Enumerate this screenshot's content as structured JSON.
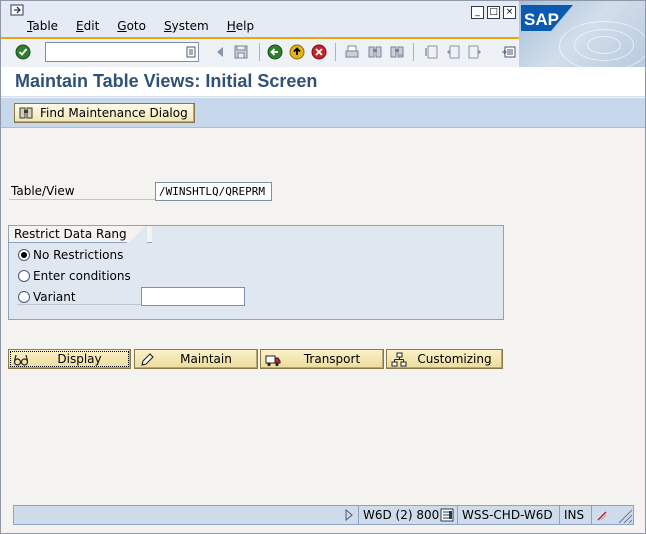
{
  "menu": {
    "items": [
      {
        "label": "Table",
        "u": "T",
        "rest": "able"
      },
      {
        "label": "Edit",
        "u": "E",
        "rest": "dit"
      },
      {
        "label": "Goto",
        "u": "G",
        "rest": "oto"
      },
      {
        "label": "System",
        "u": "S",
        "rest": "ystem"
      },
      {
        "label": "Help",
        "u": "H",
        "rest": "elp"
      }
    ]
  },
  "window_buttons": {
    "minimize": "_",
    "maximize": "□",
    "close": "×"
  },
  "logo": {
    "text": "SAP"
  },
  "toolbar": {
    "command_value": "",
    "icons": [
      "enter-icon",
      "command-dropdown-icon",
      "back-arrow-icon",
      "save-icon",
      "back-icon",
      "exit-icon",
      "cancel-icon",
      "print-icon",
      "find-icon",
      "find-next-icon",
      "first-page-icon",
      "previous-page-icon",
      "next-page-icon",
      "last-page-icon",
      "create-session-icon"
    ]
  },
  "title": "Maintain Table Views: Initial Screen",
  "app_toolbar": {
    "find_button": "Find Maintenance Dialog"
  },
  "form": {
    "table_view_label": "Table/View",
    "table_view_value": "/WINSHTLQ/QREPRM"
  },
  "restrict": {
    "title": "Restrict Data Range",
    "options": [
      {
        "label": "No Restrictions",
        "selected": true
      },
      {
        "label": "Enter conditions",
        "selected": false
      },
      {
        "label": "Variant",
        "selected": false
      }
    ],
    "variant_value": ""
  },
  "actions": {
    "display": "Display",
    "maintain": "Maintain",
    "transport": "Transport",
    "customizing": "Customizing"
  },
  "status": {
    "system": "W6D (2) 800",
    "server": "WSS-CHD-W6D",
    "mode": "INS"
  },
  "colors": {
    "title": "#2f5177",
    "accent": "#e8a80d",
    "button_face": "#f1e6b8",
    "app_toolbar": "#c7d8ec"
  }
}
